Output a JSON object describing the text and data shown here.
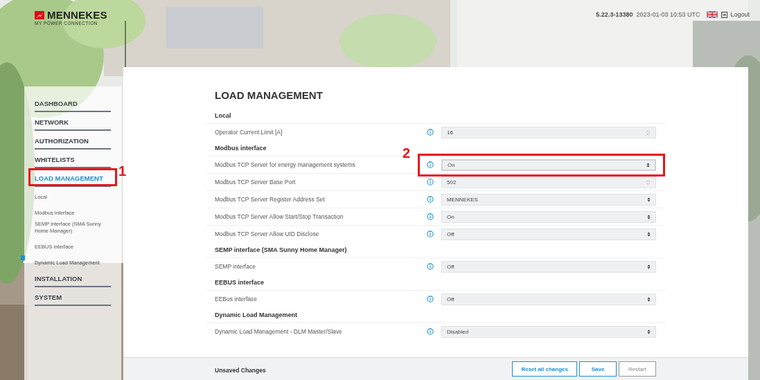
{
  "header": {
    "brand": "MENNEKES",
    "tagline": "MY POWER CONNECTION",
    "version": "5.22.3-13380",
    "datetime": "2023-01-03 10:53 UTC",
    "logout": "Logout"
  },
  "sidebar": {
    "items": [
      {
        "label": "DASHBOARD",
        "kind": "section",
        "selected": false
      },
      {
        "label": "NETWORK",
        "kind": "section",
        "selected": false
      },
      {
        "label": "AUTHORIZATION",
        "kind": "section",
        "selected": false
      },
      {
        "label": "WHITELISTS",
        "kind": "section",
        "selected": false
      },
      {
        "label": "LOAD MANAGEMENT",
        "kind": "section",
        "selected": true,
        "annotation": "1"
      },
      {
        "label": "Local",
        "kind": "sub",
        "selected": false
      },
      {
        "label": "Modbus interface",
        "kind": "sub",
        "selected": false
      },
      {
        "label": "SEMP interface (SMA Sunny Home Manager)",
        "kind": "sub",
        "selected": false
      },
      {
        "label": "EEBUS interface",
        "kind": "sub",
        "selected": false
      },
      {
        "label": "Dynamic Load Management",
        "kind": "sub",
        "selected": true
      },
      {
        "label": "INSTALLATION",
        "kind": "section",
        "selected": false
      },
      {
        "label": "SYSTEM",
        "kind": "section",
        "selected": false
      }
    ]
  },
  "main": {
    "title": "LOAD MANAGEMENT",
    "groups": [
      {
        "heading": "Local",
        "settings": [
          {
            "label": "Operator Current Limit [A]",
            "kind": "number",
            "value": "16"
          }
        ]
      },
      {
        "heading": "Modbus interface",
        "settings": [
          {
            "label": "Modbus TCP Server for energy management systems",
            "kind": "select",
            "value": "On",
            "annotation": "2"
          },
          {
            "label": "Modbus TCP Server Base Port",
            "kind": "number",
            "value": "502"
          },
          {
            "label": "Modbus TCP Server Register Address Set",
            "kind": "select",
            "value": "MENNEKES"
          },
          {
            "label": "Modbus TCP Server Allow Start/Stop Transaction",
            "kind": "select",
            "value": "On"
          },
          {
            "label": "Modbus TCP Server Allow UID Disclose",
            "kind": "select",
            "value": "Off"
          }
        ]
      },
      {
        "heading": "SEMP interface (SMA Sunny Home Manager)",
        "settings": [
          {
            "label": "SEMP interface",
            "kind": "select",
            "value": "Off"
          }
        ]
      },
      {
        "heading": "EEBUS interface",
        "settings": [
          {
            "label": "EEBus interface",
            "kind": "select",
            "value": "Off"
          }
        ]
      },
      {
        "heading": "Dynamic Load Management",
        "settings": [
          {
            "label": "Dynamic Load Management - DLM Master/Slave",
            "kind": "select",
            "value": "Disabled"
          }
        ]
      }
    ]
  },
  "footer": {
    "status": "Unsaved Changes",
    "buttons": [
      {
        "label": "Reset all changes",
        "disabled": false
      },
      {
        "label": "Save",
        "disabled": false
      },
      {
        "label": "Restart",
        "disabled": true
      }
    ]
  }
}
